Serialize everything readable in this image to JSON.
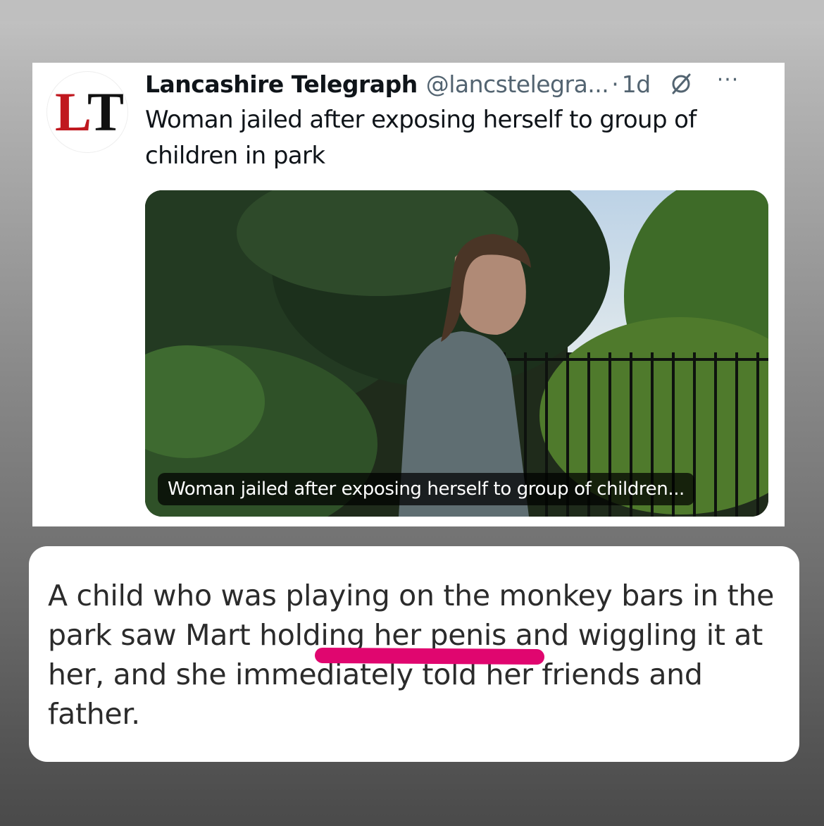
{
  "tweet": {
    "author_name": "Lancashire Telegraph",
    "author_handle": "@lancstelegra...",
    "separator": "·",
    "time": "1d",
    "avatar_logo": "LT",
    "more_icon": "more-options-icon",
    "grok_icon": "grok-icon",
    "text": "Woman jailed after exposing herself to group of children in park",
    "media_caption": "Woman jailed after exposing herself to group of children..."
  },
  "quote": {
    "text": "A child who was playing on the monkey bars in the park saw Mart holding her penis and wiggling it at her, and she immediately told her friends and father.",
    "highlight_color": "#e0066f"
  },
  "colors": {
    "logo_red": "#c0181f",
    "logo_black": "#111111",
    "handle_gray": "#536471"
  }
}
